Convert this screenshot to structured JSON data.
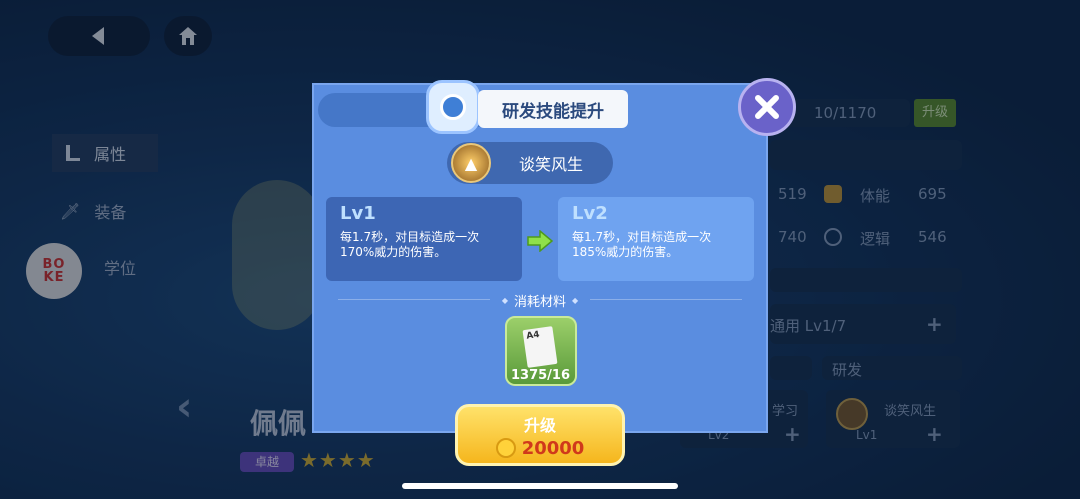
{
  "nav": {
    "back_icon": "back-arrow-icon",
    "home_icon": "home-icon"
  },
  "sidebar": {
    "items": [
      {
        "label": "属性",
        "icon": "stats-icon"
      },
      {
        "label": "装备",
        "icon": "sword-icon"
      },
      {
        "label": "学位",
        "icon": "degree-icon"
      }
    ],
    "logo_text": "BOKE"
  },
  "background": {
    "exp_text": "10/1170",
    "upgrade_tag": "升级",
    "stats": [
      {
        "value": "519"
      },
      {
        "label": "体能",
        "value": "695"
      },
      {
        "value": "740"
      },
      {
        "label": "逻辑",
        "value": "546"
      }
    ],
    "general_label": "通用 Lv1/7",
    "research_label": "研发",
    "study_label": "学习",
    "skill_name": "谈笑风生",
    "skill_level": "Lv1",
    "left_lv": "Lv2",
    "char_name": "佩佩",
    "rank_tag": "卓越",
    "stars": 4
  },
  "dialog": {
    "title": "研发技能提升",
    "skill_name": "谈笑风生",
    "current": {
      "level": "Lv1",
      "desc": "每1.7秒，对目标造成一次170%威力的伤害。"
    },
    "next": {
      "level": "Lv2",
      "desc": "每1.7秒，对目标造成一次185%威力的伤害。"
    },
    "materials_label": "消耗材料",
    "material": {
      "name": "A4",
      "count": "1375/16"
    },
    "upgrade": {
      "label": "升级",
      "cost": "20000"
    }
  },
  "colors": {
    "dialog_bg": "#5a8de0",
    "upgrade_btn": "#f5c42c",
    "cost_text": "#d0391b",
    "level_label": "#bfe0ff"
  }
}
